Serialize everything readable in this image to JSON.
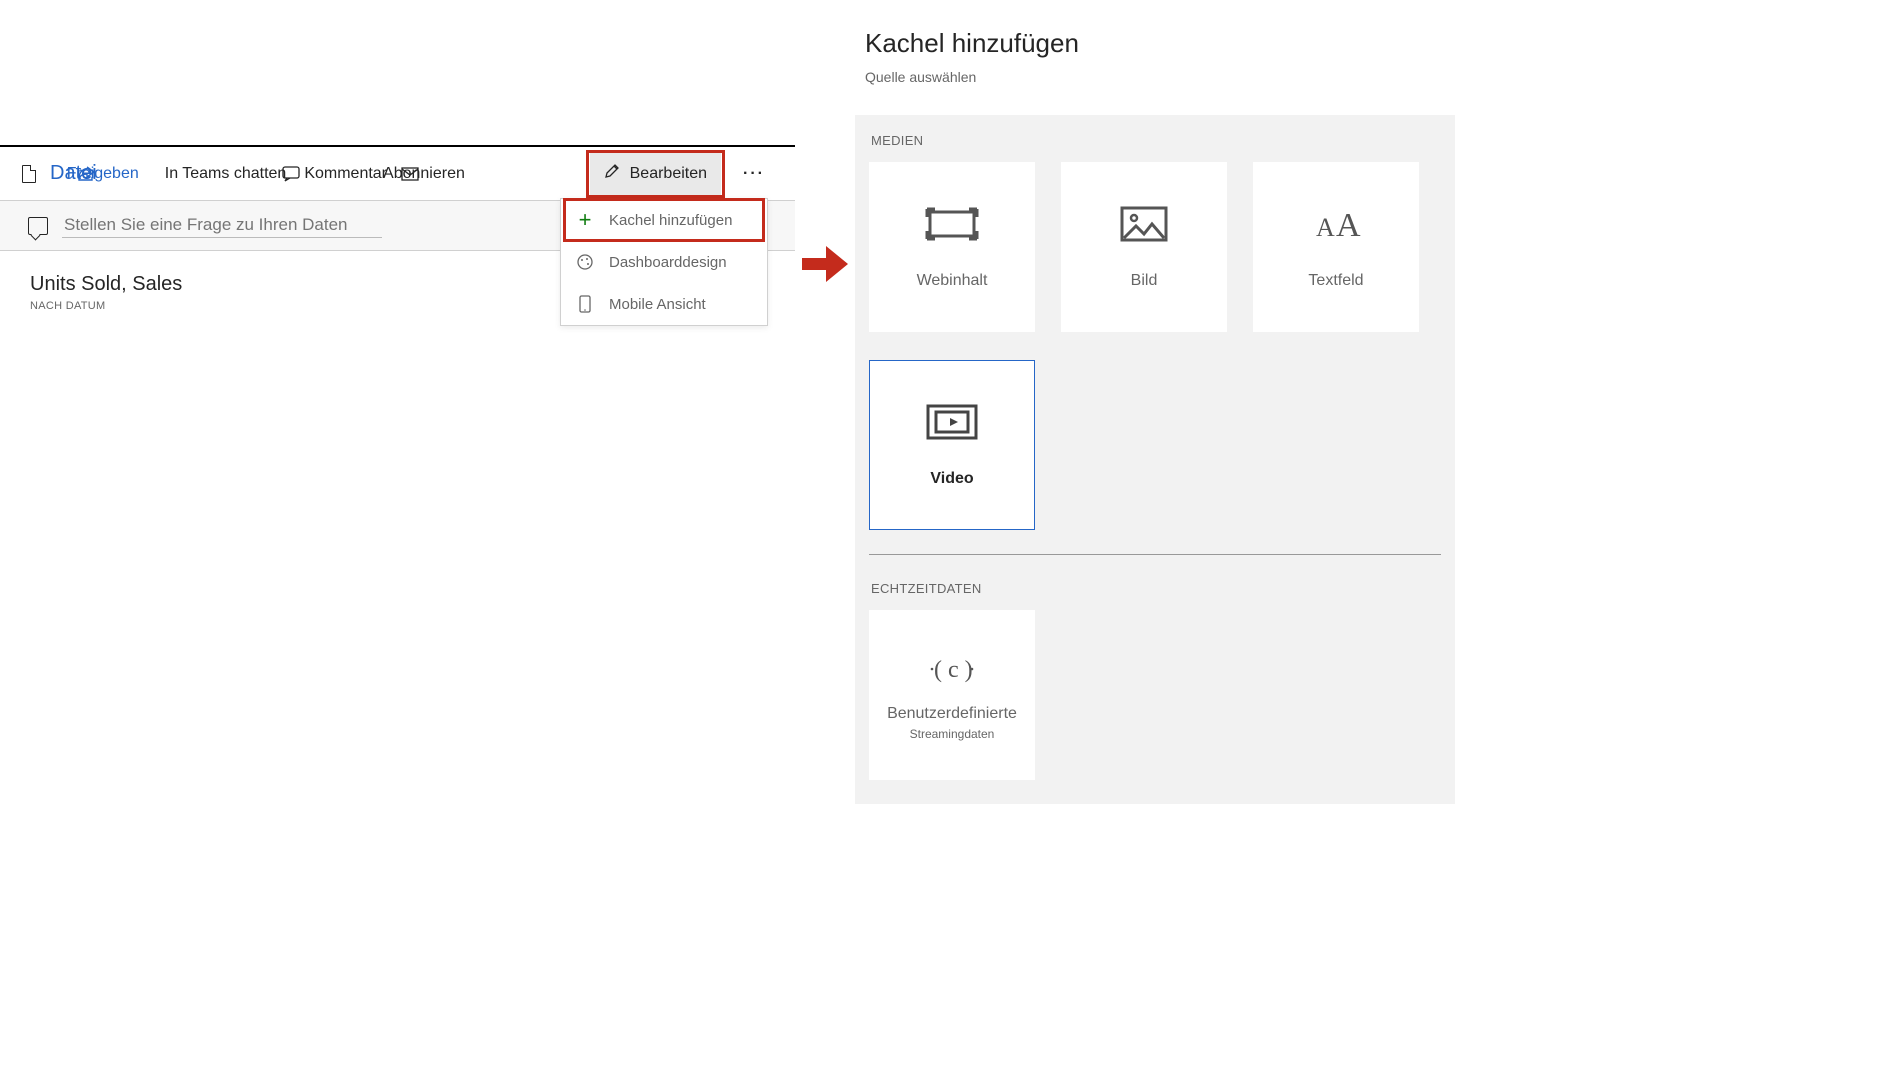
{
  "topbar": {
    "file_label": "Datei",
    "share_label": "Freigeben",
    "teams_label": "In Teams chatten",
    "comment_label": "Kommentar",
    "subscribe_label": "Abonnieren",
    "edit_label": "Bearbeiten"
  },
  "qna": {
    "placeholder": "Stellen Sie eine Frage zu Ihren Daten"
  },
  "tile": {
    "title": "Units Sold, Sales",
    "subtitle": "NACH DATUM"
  },
  "menu": {
    "add_tile": "Kachel hinzufügen",
    "dashboard_theme": "Dashboarddesign",
    "mobile_view": "Mobile Ansicht"
  },
  "add_tile_panel": {
    "title": "Kachel hinzufügen",
    "subtitle": "Quelle auswählen",
    "section_media": "MEDIEN",
    "section_realtime": "ECHTZEITDATEN",
    "cards": {
      "web": "Webinhalt",
      "image": "Bild",
      "text": "Textfeld",
      "video": "Video",
      "streaming_title": "Benutzerdefinierte",
      "streaming_sub": "Streamingdaten"
    }
  }
}
